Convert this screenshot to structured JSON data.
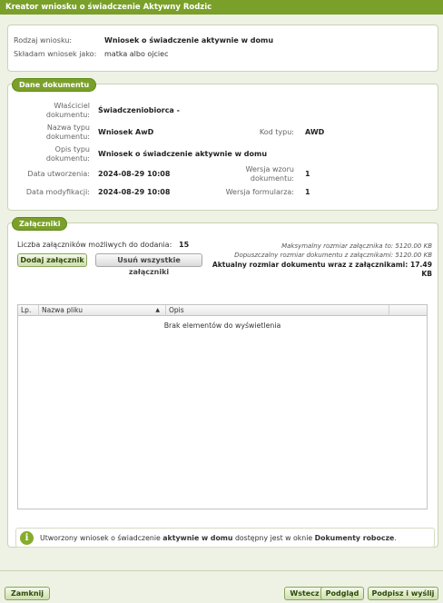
{
  "window": {
    "title": "Kreator wniosku o świadczenie Aktywny Rodzic"
  },
  "header": {
    "rodzaj_label": "Rodzaj wniosku:",
    "rodzaj_value": "Wniosek o świadczenie aktywnie w domu",
    "skladam_label": "Składam wniosek jako:",
    "skladam_value": "matka albo ojciec"
  },
  "dane": {
    "legend": "Dane dokumentu",
    "wlasciciel_label": "Właściciel dokumentu:",
    "wlasciciel_value": "Świadczeniobiorca -",
    "nazwa_typu_label": "Nazwa typu dokumentu:",
    "nazwa_typu_value": "Wniosek AwD",
    "kod_typu_label": "Kod typu:",
    "kod_typu_value": "AWD",
    "opis_typu_label": "Opis typu dokumentu:",
    "opis_typu_value": "Wniosek o świadczenie aktywnie w domu",
    "data_utw_label": "Data utworzenia:",
    "data_utw_value": "2024-08-29 10:08",
    "wersja_wzoru_label": "Wersja wzoru dokumentu:",
    "wersja_wzoru_value": "1",
    "data_mod_label": "Data modyfikacji:",
    "data_mod_value": "2024-08-29 10:08",
    "wersja_form_label": "Wersja formularza:",
    "wersja_form_value": "1"
  },
  "zalaczniki": {
    "legend": "Załączniki",
    "liczba_label": "Liczba załączników możliwych do dodania:",
    "liczba_value": "15",
    "max_rozmiar": "Maksymalny rozmiar załącznika to: 5120.00 KB",
    "dopuszczalny": "Dopuszczalny rozmiar dokumentu z załącznikami: 5120.00 KB",
    "aktualny_line1": "Aktualny rozmiar dokumentu wraz z załącznikami: 17.49",
    "aktualny_line2": "KB",
    "add_button": "Dodaj załącznik",
    "remove_all_button": "Usuń wszystkie załączniki",
    "columns": [
      "Lp.",
      "Nazwa pliku",
      "Opis"
    ],
    "sort_indicator": "▲",
    "empty_text": "Brak elementów do wyświetlenia"
  },
  "info": {
    "icon": "info-icon",
    "text_before": "Utworzony wniosek o świadczenie ",
    "text_bold1": "aktywnie w domu",
    "text_mid": " dostępny jest w oknie ",
    "text_bold2": "Dokumenty robocze",
    "text_end": "."
  },
  "footer": {
    "close_button": "Zamknij",
    "back_button": "Wstecz",
    "preview_button": "Podgląd",
    "sign_button": "Podpisz i wyślij"
  },
  "colors": {
    "accent": "#7aa02a",
    "background": "#eef2e4"
  }
}
